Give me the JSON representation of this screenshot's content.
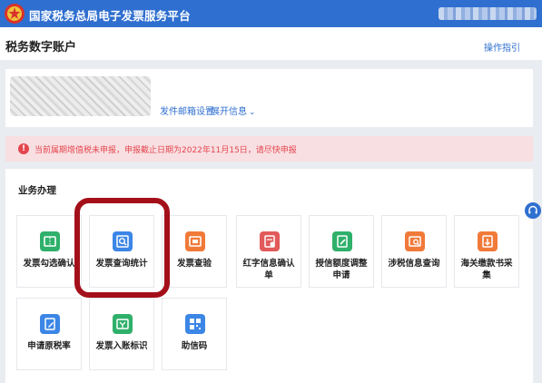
{
  "header": {
    "title": "国家税务总局电子发票服务平台"
  },
  "page": {
    "title": "税务数字账户",
    "guide_link": "操作指引"
  },
  "account": {
    "mail_settings": "发件邮箱设置",
    "expand_info": "展开信息"
  },
  "alert": {
    "text": "当前属期增值税未申报，申报截止日期为2022年11月15日，请尽快申报"
  },
  "business": {
    "title": "业务办理",
    "tiles": [
      {
        "label": "发票勾选确认",
        "icon": "ticket-icon"
      },
      {
        "label": "发票查询统计",
        "icon": "document-search-icon"
      },
      {
        "label": "发票查验",
        "icon": "ticket-verify-icon"
      },
      {
        "label": "红字信息确认单",
        "icon": "red-form-icon"
      },
      {
        "label": "授信额度调整申请",
        "icon": "edit-form-icon"
      },
      {
        "label": "涉税信息查询",
        "icon": "tax-search-icon"
      },
      {
        "label": "海关缴款书采集",
        "icon": "customs-doc-icon"
      },
      {
        "label": "申请原税率",
        "icon": "pen-doc-icon"
      },
      {
        "label": "发票入账标识",
        "icon": "invoice-tag-icon"
      },
      {
        "label": "助信码",
        "icon": "qr-code-icon"
      }
    ]
  },
  "colors": {
    "brand_blue": "#2f6fd0",
    "green": "#2fb06b",
    "blue": "#3c86e6",
    "orange": "#f17a3a",
    "alert_red": "#e4464e",
    "highlight": "#a3101a"
  }
}
